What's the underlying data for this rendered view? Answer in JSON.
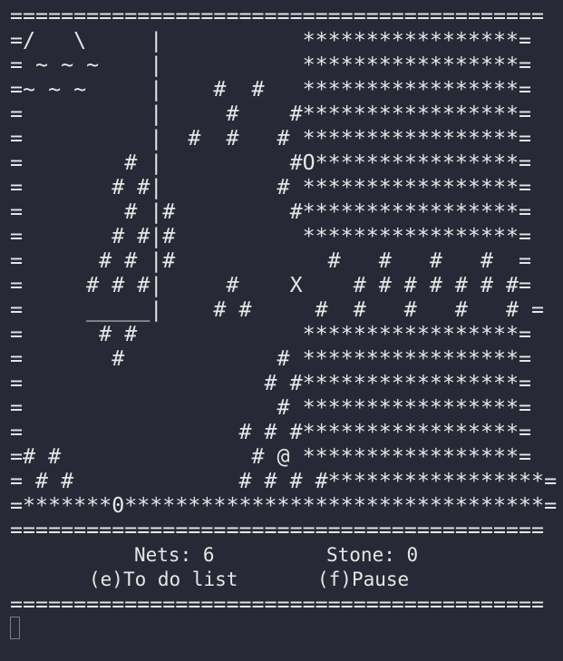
{
  "screen": {
    "map_rows": [
      "==========================================",
      "=/   \\     |           *****************=",
      "= ~ ~ ~    |           *****************=",
      "=~ ~ ~     |    #  #   *****************=",
      "=          |     #    #*****************=",
      "=          |  #  #   # *****************=",
      "=        # |          #O****************=",
      "=       # #|         # *****************=",
      "=        # |#         #*****************=",
      "=       # #|#          *****************=",
      "=      # # |#            #   #   #   #  =",
      "=     # # #|     #    X    # # # # # # #=",
      "=     _____|    # #     #  #   #   #   # =",
      "=      # #             *****************=",
      "=       #            # *****************=",
      "=                   # #*****************=",
      "=                    # *****************=",
      "=                 # # #*****************=",
      "=# #               # @ *****************=",
      "= # #             # # # #*****************=",
      "=*******0*********************************=",
      "=========================================="
    ],
    "nets_label": "Nets:",
    "nets_value": "6",
    "stone_label": "Stone:",
    "stone_value": "0",
    "todo_key": "(e)",
    "todo_label": "To do list",
    "pause_key": "(f)",
    "pause_label": "Pause",
    "bottom_rule": "=========================================="
  }
}
